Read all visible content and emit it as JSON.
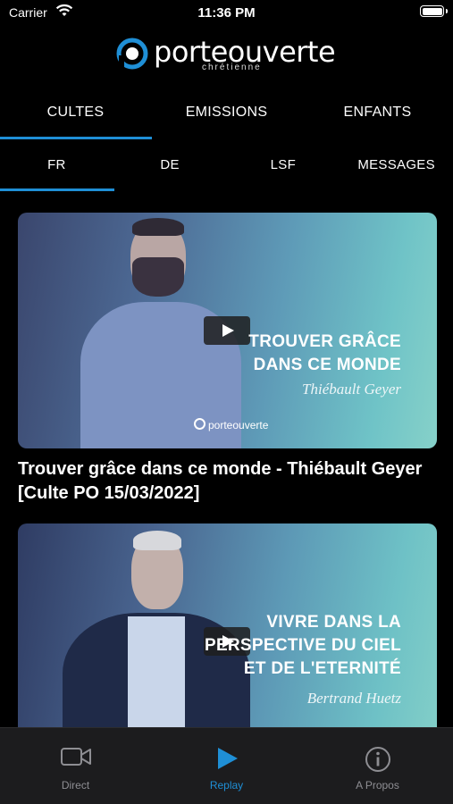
{
  "status_bar": {
    "carrier": "Carrier",
    "time": "11:36 PM"
  },
  "logo": {
    "brand": "porteouverte",
    "sub": "chrétienne"
  },
  "category_tabs": [
    {
      "label": "CULTES",
      "active": true
    },
    {
      "label": "EMISSIONS",
      "active": false
    },
    {
      "label": "ENFANTS",
      "active": false
    }
  ],
  "language_tabs": [
    {
      "label": "FR",
      "active": true
    },
    {
      "label": "DE",
      "active": false
    },
    {
      "label": "LSF",
      "active": false
    },
    {
      "label": "MESSAGES",
      "active": false
    }
  ],
  "videos": [
    {
      "thumb_title_line1": "TROUVER GRÂCE",
      "thumb_title_line2": "DANS CE MONDE",
      "thumb_speaker": "Thiébault Geyer",
      "watermark": "porteouverte",
      "caption": "Trouver grâce dans ce monde - Thiébault Geyer [Culte PO 15/03/2022]"
    },
    {
      "thumb_title_line1": "VIVRE DANS LA",
      "thumb_title_line2": "PERSPECTIVE DU CIEL",
      "thumb_title_line3": "ET DE L'ETERNITÉ",
      "thumb_speaker": "Bertrand Huetz"
    }
  ],
  "tab_bar": [
    {
      "label": "Direct",
      "icon": "video-camera-icon",
      "active": false
    },
    {
      "label": "Replay",
      "icon": "play-icon",
      "active": true
    },
    {
      "label": "A Propos",
      "icon": "info-icon",
      "active": false
    }
  ],
  "colors": {
    "accent": "#1f8fd6",
    "background": "#000000",
    "tabbar": "#1c1c1e",
    "inactive": "#8e8e93"
  }
}
